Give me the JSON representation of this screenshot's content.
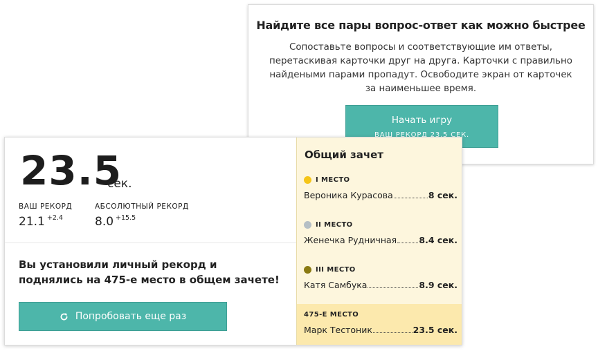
{
  "start_card": {
    "title": "Найдите все пары вопрос-ответ как можно быстрее",
    "description": "Сопоставьте вопросы и соответствующие им ответы, перетаскивая карточки друг на друга. Карточки с правильно найдеными парами пропадут. Освободите экран от карточек за наименьшее время.",
    "button_label": "Начать игру",
    "button_sub": "ВАШ РЕКОРД 23.5 СЕК."
  },
  "result": {
    "score": "23.5",
    "unit": "сек.",
    "your_record_label": "ВАШ РЕКОРД",
    "your_record_value": "21.1",
    "your_record_diff": "+2.4",
    "absolute_record_label": "АБСОЛЮТНЫЙ РЕКОРД",
    "absolute_record_value": "8.0",
    "absolute_record_diff": "+15.5",
    "message": "Вы установили личный рекорд и поднялись на 475-е место в общем зачете!",
    "retry_label": "Попробовать еще раз"
  },
  "leaderboard": {
    "title": "Общий зачет",
    "entries": [
      {
        "place": "I МЕСТО",
        "name": "Вероника Курасова",
        "time": "8 сек.",
        "medal_color": "#f5c518"
      },
      {
        "place": "II МЕСТО",
        "name": "Женечка Рудничная",
        "time": "8.4 сек.",
        "medal_color": "#b5bfc5"
      },
      {
        "place": "III МЕСТО",
        "name": "Катя Самбука",
        "time": "8.9 сек.",
        "medal_color": "#8a7a12"
      }
    ],
    "user": {
      "place": "475-Е МЕСТО",
      "name": "Марк Тестоник",
      "time": "23.5 сек."
    }
  },
  "colors": {
    "accent": "#4db6aa",
    "leaderboard_bg": "#fdf6dd",
    "user_row_bg": "#fce9ad"
  }
}
